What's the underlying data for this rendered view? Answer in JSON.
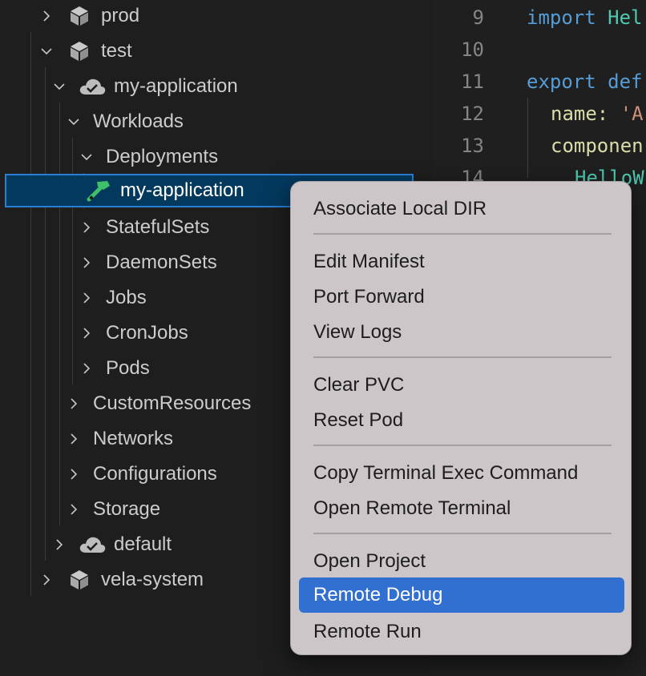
{
  "tree": {
    "items": [
      {
        "label": "prod",
        "icon": "cube-icon",
        "expanded": false
      },
      {
        "label": "test",
        "icon": "cube-icon",
        "expanded": true
      },
      {
        "label": "my-application",
        "icon": "cloud-check-icon",
        "expanded": true
      },
      {
        "label": "Workloads",
        "expanded": true
      },
      {
        "label": "Deployments",
        "expanded": true
      },
      {
        "label": "my-application",
        "icon": "hammer-icon",
        "selected": true
      },
      {
        "label": "StatefulSets",
        "expanded": false
      },
      {
        "label": "DaemonSets",
        "expanded": false
      },
      {
        "label": "Jobs",
        "expanded": false
      },
      {
        "label": "CronJobs",
        "expanded": false
      },
      {
        "label": "Pods",
        "expanded": false
      },
      {
        "label": "CustomResources",
        "expanded": false
      },
      {
        "label": "Networks",
        "expanded": false
      },
      {
        "label": "Configurations",
        "expanded": false
      },
      {
        "label": "Storage",
        "expanded": false
      },
      {
        "label": "default",
        "icon": "cloud-check-icon",
        "expanded": false
      },
      {
        "label": "vela-system",
        "icon": "cube-icon",
        "expanded": false
      }
    ]
  },
  "editor": {
    "line_numbers": [
      "9",
      "10",
      "11",
      "12",
      "13",
      "14"
    ],
    "line9": {
      "keyword": "import",
      "rest": " Hel"
    },
    "line11": {
      "keyword": "export",
      "rest": " def"
    },
    "line12": {
      "prop": "name:",
      "str": " 'A"
    },
    "line13": {
      "prop": "componen"
    },
    "line14": {
      "id": "HelloW"
    }
  },
  "context_menu": {
    "groups": [
      [
        "Associate Local DIR"
      ],
      [
        "Edit Manifest",
        "Port Forward",
        "View Logs"
      ],
      [
        "Clear PVC",
        "Reset Pod"
      ],
      [
        "Copy Terminal Exec Command",
        "Open Remote Terminal"
      ],
      [
        "Open Project",
        "Remote Debug",
        "Remote Run"
      ]
    ],
    "active_item": "Remote Debug"
  },
  "colors": {
    "accent": "#3170d0",
    "selection": "#04395e",
    "menu_bg": "#cdc6c9"
  }
}
